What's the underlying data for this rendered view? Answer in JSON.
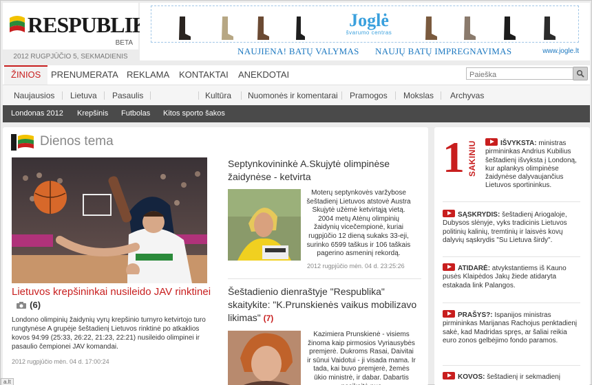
{
  "header": {
    "logo_text": "RESPUBLIKA",
    "beta": "BETA",
    "date": "2012 RUGPJŪČIO 5, SEKMADIENIS"
  },
  "ad": {
    "brand": "Joglė",
    "brand_sub": "švarumo centras",
    "line1": "NAUJIENA! BATŲ VALYMAS",
    "line2": "NAUJŲ BATŲ IMPREGNAVIMAS",
    "url": "www.jogle.lt"
  },
  "nav": {
    "main": [
      "ŽINIOS",
      "PRENUMERATA",
      "REKLAMA",
      "KONTAKTAI",
      "ANEKDOTAI"
    ],
    "search_placeholder": "Paieška",
    "sub": [
      "Naujausios",
      "Lietuva",
      "Pasaulis",
      "Kultūra",
      "Nuomonės ir komentarai",
      "Pramogos",
      "Mokslas",
      "Archyvas"
    ],
    "sport": [
      "Londonas 2012",
      "Krepšinis",
      "Futbolas",
      "Kitos sporto šakos"
    ]
  },
  "main": {
    "section_title": "Dienos tema",
    "lead": {
      "title": "Lietuvos krepšininkai nusileido JAV rinktinei",
      "photo_count": "(6)",
      "text": "Londono olimpinių žaidynių vyrų krepšinio turnyro ketvirtojo turo rungtynėse A grupėje šeštadienį Lietuvos rinktinė po atkaklios kovos 94:99 (25:33, 26:22, 21:23, 22:21) nusileido olimpinei ir pasaulio čempionei JAV komandai.",
      "date": "2012 rugpjūčio mėn. 04 d. 17:00:24"
    },
    "article1": {
      "title": "Septynkovininkė A.Skujytė olimpinėse žaidynėse - ketvirta",
      "text": "Moterų septynkovės varžybose šeštadienį Lietuvos atstovė Austra Skujytė užėmė ketvirtąją vietą. 2004 metų Atėnų olimpinių žaidynių vicečempionė, kuriai rugpjūčio 12 dieną sukaks 33-eji, surinko 6599 taškus ir 106 taškais pagerino asmeninį rekordą.",
      "date": "2012 rugpjūčio mėn. 04 d. 23:25:26"
    },
    "article2": {
      "title": "Šeštadienio dienraštyje \"Respublika\" skaitykite: \"K.Prunskienės vaikus mobilizavo likimas\"",
      "count": "(7)",
      "text": "Kazimiera Prunskienė - visiems žinoma kaip pirmosios Vyriausybės premjerė. Dukroms Rasai, Daivitai ir sūnui Vaidotui - ji visada mama. Ir tada, kai buvo premjerė, žemės ūkio ministrė, ir dabar. Dabartis pasikeitė nuo"
    }
  },
  "side": {
    "badge_num": "1",
    "badge_word": "SAKINIU",
    "items": [
      {
        "label": "IŠVYKSTA:",
        "text": " ministras pirmininkas Andrius Kubilius šeštadienį išvyksta į Londoną, kur aplankys olimpinėse žaidynėse dalyvaujančius Lietuvos sportininkus."
      },
      {
        "label": "SĄSKRYDIS:",
        "text": " šeštadienį Ariogaloje, Dubysos slėnyje, vyks tradicinis Lietuvos politinių kalinių, tremtinių ir laisvės kovų dalyvių sąskrydis \"Su Lietuva širdy\"."
      },
      {
        "label": "ATIDARĖ:",
        "text": " atvykstantiems iš Kauno pusės Klaipėdos Jakų žiede atidaryta estakada link Palangos."
      },
      {
        "label": "PRAŠYS?:",
        "text": " Ispanijos ministras pirmininkas Marijanas Rachojus penktadienį sakė, kad Madridas spręs, ar šaliai reikia euro zonos gelbėjimo fondo paramos."
      },
      {
        "label": "KOVOS:",
        "text": " šeštadienį ir sekmadienį"
      }
    ]
  },
  "status_url": "a.lt",
  "colors": {
    "accent": "#c81e1e",
    "ad_blue": "#1c78c0",
    "sport_bar": "#4a4a4a"
  }
}
